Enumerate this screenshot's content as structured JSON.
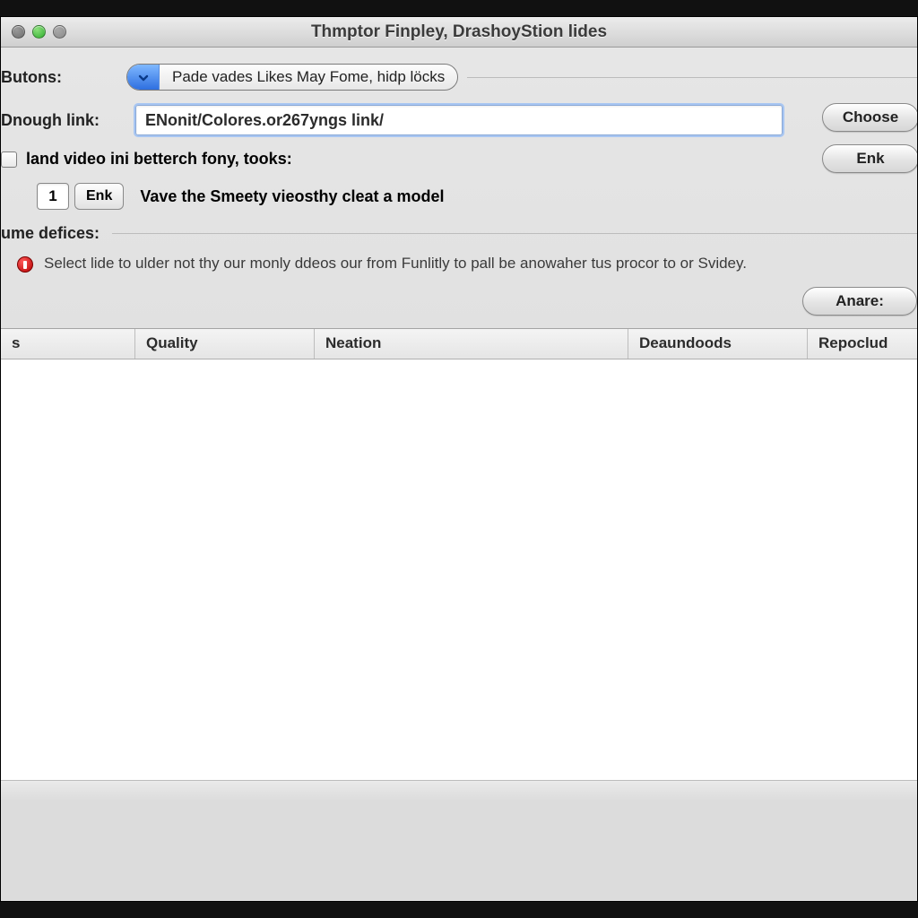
{
  "window": {
    "title": "Thmptor Finpley, DrashoyStion lides"
  },
  "butons": {
    "label": "Butons:",
    "dropdown_text": "Pade vades Likes May Fome, hidp löcks"
  },
  "link": {
    "label": "Dnough link:",
    "value": "ENonit/Colores.or267yngs link/",
    "choose": "Choose",
    "enk": "Enk"
  },
  "video_check": {
    "label": "land video ini betterch fony, tooks:"
  },
  "stepper": {
    "value": "1",
    "btn": "Enk",
    "note": "Vave the Smeety vieosthy cleat a model"
  },
  "defices": {
    "label": "ume defices:",
    "alert": "Select lide to ulder not thy our monly ddeos our from Funlitly to pall be anowaher tus procor to or Svidey."
  },
  "anare": {
    "label": "Anare:"
  },
  "table": {
    "c0": "s",
    "c1": "Quality",
    "c2": "Neation",
    "c3": "Deaundoods",
    "c4": "Repoclud"
  }
}
